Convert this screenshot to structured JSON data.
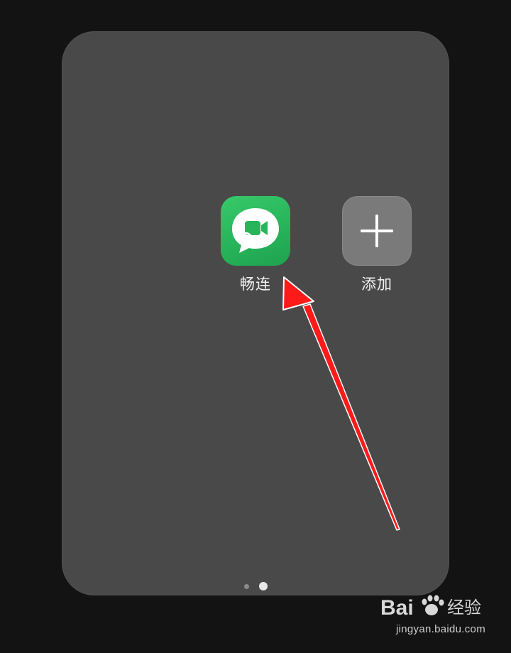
{
  "folder": {
    "apps": [
      {
        "label": "畅连",
        "icon": "changlian-video-chat-icon"
      },
      {
        "label": "添加",
        "icon": "plus-icon"
      }
    ],
    "pagination": {
      "total_pages": 2,
      "current_page": 2
    }
  },
  "watermark": {
    "logo_text": "Bai经验",
    "logo_prefix": "Bai",
    "logo_suffix": "经验",
    "url": "jingyan.baidu.com"
  },
  "colors": {
    "background": "#131313",
    "panel": "#494949",
    "app_green": "#2bbd5f",
    "add_tile": "#7a7a7a",
    "arrow": "#ff0000"
  }
}
